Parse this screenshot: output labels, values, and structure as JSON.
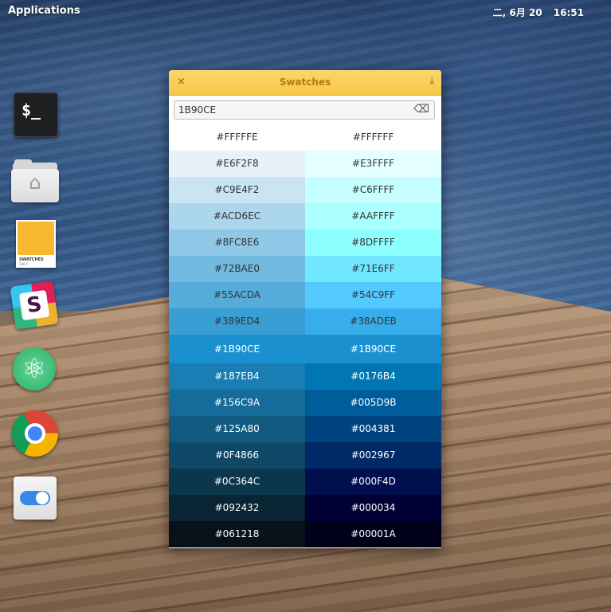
{
  "panel": {
    "applications": "Applications",
    "date": "二, 6月 20",
    "time": "16:51"
  },
  "launcher": {
    "terminal_glyph": "$_",
    "swatches_icon_text": "SWATCHES",
    "swatches_icon_sub": "136 C"
  },
  "window": {
    "title": "Swatches",
    "close_glyph": "×",
    "download_glyph": "⤓",
    "search_value": "1B90CE",
    "clear_glyph": "⌫"
  },
  "swatches": {
    "selected_index": 8,
    "left": [
      {
        "hex": "#FFFFFE",
        "text": "#333333"
      },
      {
        "hex": "#E6F2F8",
        "text": "#333333"
      },
      {
        "hex": "#C9E4F2",
        "text": "#333333"
      },
      {
        "hex": "#ACD6EC",
        "text": "#333333"
      },
      {
        "hex": "#8FC8E6",
        "text": "#333333"
      },
      {
        "hex": "#72BAE0",
        "text": "#333333"
      },
      {
        "hex": "#55ACDA",
        "text": "#333333"
      },
      {
        "hex": "#389ED4",
        "text": "#333333"
      },
      {
        "hex": "#1B90CE",
        "text": "#ffffff"
      },
      {
        "hex": "#187EB4",
        "text": "#ffffff"
      },
      {
        "hex": "#156C9A",
        "text": "#ffffff"
      },
      {
        "hex": "#125A80",
        "text": "#ffffff"
      },
      {
        "hex": "#0F4866",
        "text": "#ffffff"
      },
      {
        "hex": "#0C364C",
        "text": "#ffffff"
      },
      {
        "hex": "#092432",
        "text": "#ffffff"
      },
      {
        "hex": "#061218",
        "text": "#ffffff"
      }
    ],
    "right": [
      {
        "hex": "#FFFFFF",
        "text": "#333333"
      },
      {
        "hex": "#E3FFFF",
        "text": "#333333"
      },
      {
        "hex": "#C6FFFF",
        "text": "#333333"
      },
      {
        "hex": "#AAFFFF",
        "text": "#333333"
      },
      {
        "hex": "#8DFFFF",
        "text": "#333333"
      },
      {
        "hex": "#71E6FF",
        "text": "#333333"
      },
      {
        "hex": "#54C9FF",
        "text": "#333333"
      },
      {
        "hex": "#38ADEB",
        "text": "#333333"
      },
      {
        "hex": "#1B90CE",
        "text": "#ffffff"
      },
      {
        "hex": "#0176B4",
        "text": "#ffffff"
      },
      {
        "hex": "#005D9B",
        "text": "#ffffff"
      },
      {
        "hex": "#004381",
        "text": "#ffffff"
      },
      {
        "hex": "#002967",
        "text": "#ffffff"
      },
      {
        "hex": "#000F4D",
        "text": "#ffffff"
      },
      {
        "hex": "#000034",
        "text": "#ffffff"
      },
      {
        "hex": "#00001A",
        "text": "#ffffff"
      }
    ]
  }
}
